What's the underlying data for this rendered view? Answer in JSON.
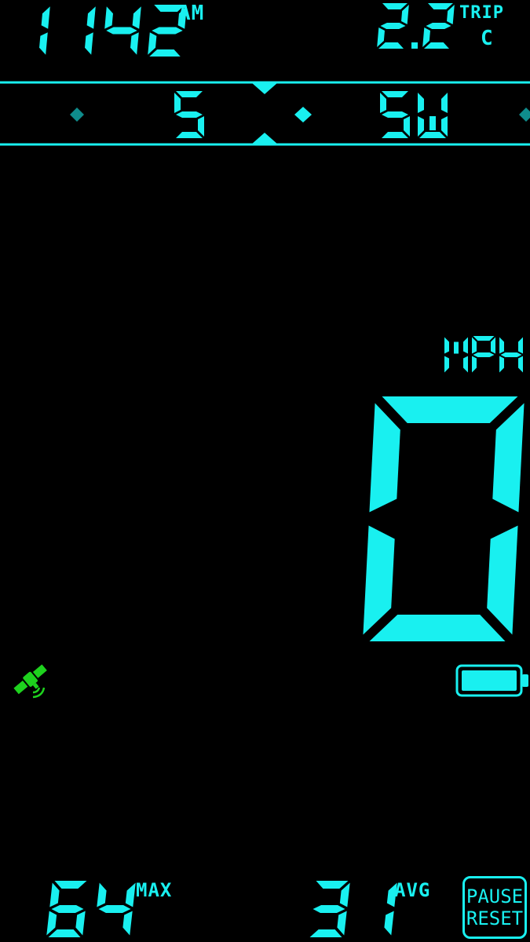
{
  "clock": {
    "time": "1142",
    "ampm": "AM"
  },
  "trip": {
    "distance": "2.2",
    "label": "TRIP",
    "sub": "C"
  },
  "compass": {
    "left_heading": "S",
    "right_heading": "SW"
  },
  "speed": {
    "unit": "MPH",
    "value": "0"
  },
  "stats": {
    "max_value": "64",
    "max_label": "MAX",
    "avg_value": "31",
    "avg_label": "AVG"
  },
  "controls": {
    "pause_label": "PAUSE",
    "reset_label": "RESET"
  },
  "status": {
    "gps_icon": "satellite-icon",
    "battery_icon": "battery-icon",
    "battery_level": 1.0
  },
  "theme": {
    "accent": "#19f0f0",
    "dim": "#0f8c8c",
    "gps": "#1ed21e",
    "background": "#000000"
  }
}
